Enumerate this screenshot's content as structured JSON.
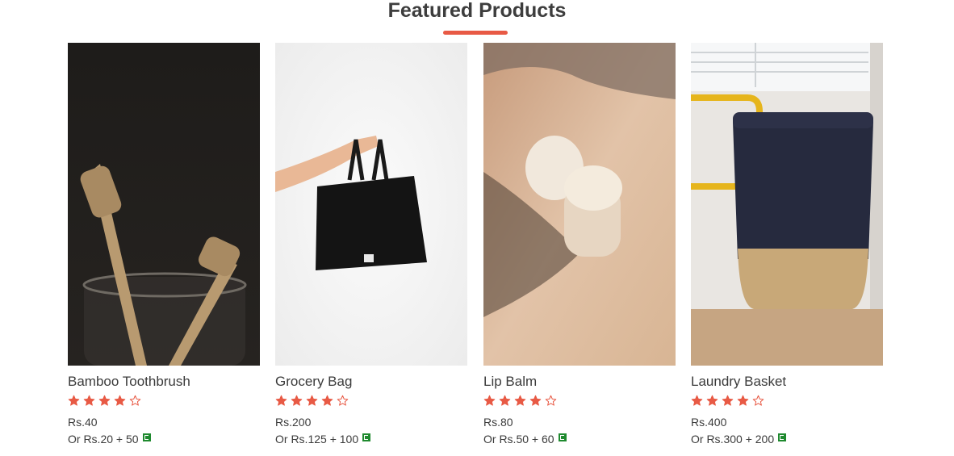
{
  "section": {
    "title": "Featured Products"
  },
  "colors": {
    "accent": "#e85a45",
    "star": "#e85a45",
    "coin": "#1f8a2f"
  },
  "products": [
    {
      "name": "Bamboo Toothbrush",
      "rating": 4,
      "max_rating": 5,
      "price": "Rs.40",
      "alt_price": "Or Rs.20 + 50",
      "image": "bamboo-toothbrush-photo"
    },
    {
      "name": "Grocery Bag",
      "rating": 4,
      "max_rating": 5,
      "price": "Rs.200",
      "alt_price": "Or Rs.125 + 100",
      "image": "grocery-bag-photo"
    },
    {
      "name": "Lip Balm",
      "rating": 4,
      "max_rating": 5,
      "price": "Rs.80",
      "alt_price": "Or Rs.50 + 60",
      "image": "lip-balm-photo"
    },
    {
      "name": "Laundry Basket",
      "rating": 4,
      "max_rating": 5,
      "price": "Rs.400",
      "alt_price": "Or Rs.300 + 200",
      "image": "laundry-basket-photo"
    }
  ]
}
